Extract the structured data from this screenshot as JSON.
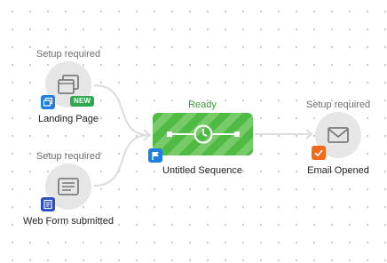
{
  "nodes": {
    "landing_page": {
      "status": "Setup required",
      "title": "Landing Page",
      "badge": "NEW",
      "icon": "window-stack-icon",
      "badge_icon": "pages-icon"
    },
    "web_form": {
      "status": "Setup required",
      "title": "Web Form submitted",
      "icon": "form-icon",
      "badge_icon": "form-badge-icon"
    },
    "sequence": {
      "status": "Ready",
      "title": "Untitled Sequence",
      "icon": "clock-icon",
      "badge_icon": "flag-icon"
    },
    "email_opened": {
      "status": "Setup required",
      "title": "Email Opened",
      "icon": "envelope-icon",
      "badge_icon": "check-icon"
    }
  },
  "colors": {
    "canvas_dot": "#c9c9c9",
    "node_circle": "#e6e6e6",
    "connector": "#dcdcdc",
    "sequence_green": "#4fba44",
    "sequence_stripe": "#77cc69",
    "ready_text": "#3a9a35",
    "badge_blue": "#1f7fe0",
    "badge_navy": "#2a4fc2",
    "badge_orange": "#ef6a1a",
    "badge_new_green": "#2fa84f"
  }
}
